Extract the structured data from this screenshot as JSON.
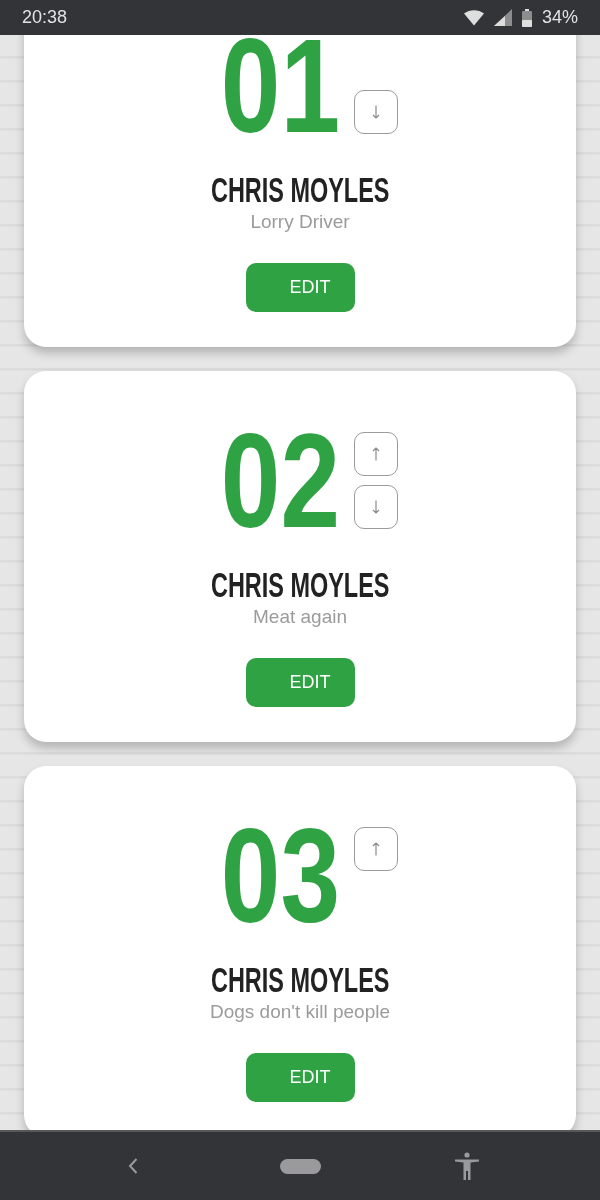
{
  "status_bar": {
    "time": "20:38",
    "battery": "34%"
  },
  "cards": [
    {
      "number": "01",
      "name": "CHRIS MOYLES",
      "subtitle": "Lorry Driver",
      "move_up": false,
      "move_down": true,
      "button": "EDIT"
    },
    {
      "number": "02",
      "name": "CHRIS MOYLES",
      "subtitle": "Meat again",
      "move_up": true,
      "move_down": true,
      "button": "EDIT"
    },
    {
      "number": "03",
      "name": "CHRIS MOYLES",
      "subtitle": "Dogs don't kill people",
      "move_up": true,
      "move_down": false,
      "button": "EDIT"
    }
  ]
}
